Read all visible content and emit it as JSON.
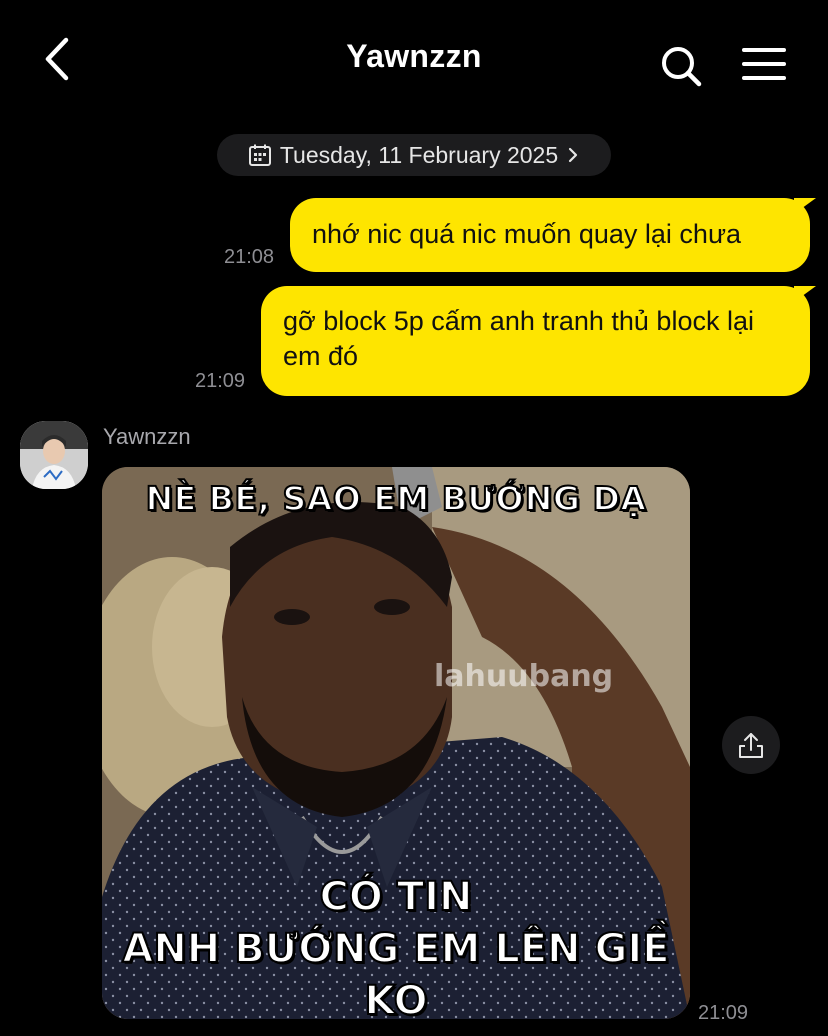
{
  "header": {
    "title": "Yawnzzn",
    "back_icon": "chevron-left-icon",
    "search_icon": "search-icon",
    "menu_icon": "hamburger-menu-icon"
  },
  "date_divider": {
    "label": "Tuesday, 11 February 2025",
    "icon": "calendar-icon",
    "chevron_icon": "chevron-right-icon"
  },
  "messages": [
    {
      "direction": "outgoing",
      "text": "nhớ nic quá nic muốn quay lại chưa",
      "time": "21:08"
    },
    {
      "direction": "outgoing",
      "text": "gỡ block 5p cấm anh tranh thủ block lại em đó",
      "time": "21:09"
    },
    {
      "direction": "incoming",
      "sender": "Yawnzzn",
      "type": "image",
      "caption_top": "NÈ BÉ, SAO EM BƯỚNG DẠ",
      "caption_bottom_line1": "CÓ TIN",
      "caption_bottom_line2": "ANH BƯỚNG EM LÊN GIỀ KO",
      "watermark": "lahuubang",
      "time": "21:09"
    }
  ],
  "share_icon": "share-icon",
  "colors": {
    "background": "#000000",
    "outgoing_bubble": "#fee500",
    "timestamp": "#8e8e93",
    "pill": "#1c1c1e"
  }
}
